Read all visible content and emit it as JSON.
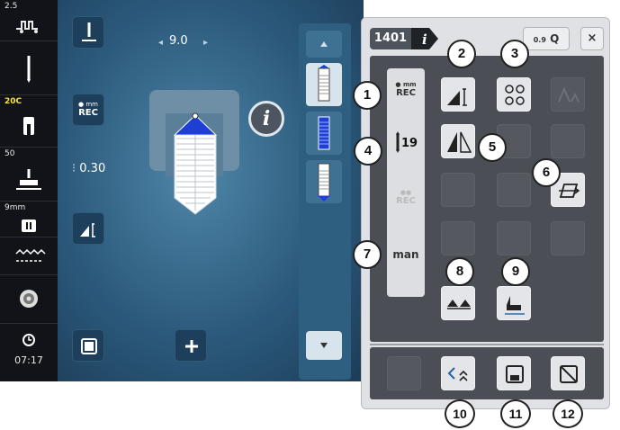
{
  "status_bar": {
    "thread_tension": "2.5",
    "needle_label": "20C",
    "presser_pressure": "50",
    "feed_dog_label": "9mm",
    "clock": "07:17"
  },
  "main": {
    "stitch_width": "9.0",
    "stitch_length": "0.30",
    "mem_rec_label": "REC",
    "mem_unit": "mm"
  },
  "dialog": {
    "stitch_number": "1401",
    "info_glyph": "i",
    "zoom_label": "Q",
    "zoom_small": "0.9",
    "close_label": "×",
    "rec_label": "REC",
    "rec_unit": "mm",
    "counter": "19",
    "man_label": "man",
    "callouts": [
      "1",
      "2",
      "3",
      "4",
      "5",
      "6",
      "7",
      "8",
      "9",
      "10",
      "11",
      "12"
    ]
  },
  "colors": {
    "accent_blue": "#2c5a7c",
    "stitch_blue": "#1e3fd6",
    "panel_gray": "#dfe1e4"
  }
}
